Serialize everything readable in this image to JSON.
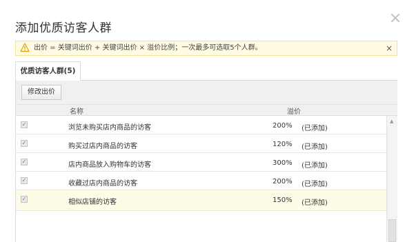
{
  "dialog": {
    "title": "添加优质访客人群",
    "close_glyph": "×"
  },
  "notice": {
    "icon": "warning-icon",
    "text": "出价 = 关键词出价 + 关键词出价 × 溢价比例；一次最多可选取5个人群。",
    "close_glyph": "×"
  },
  "tab": {
    "label": "优质访客人群(5)"
  },
  "toolbar": {
    "edit_bid_label": "修改出价"
  },
  "table": {
    "headers": {
      "name": "名称",
      "rate": "溢价"
    },
    "rows": [
      {
        "name": "浏览未购买店内商品的访客",
        "rate": "200%",
        "status": "(已添加)",
        "checked": true
      },
      {
        "name": "购买过店内商品的访客",
        "rate": "120%",
        "status": "(已添加)",
        "checked": true
      },
      {
        "name": "店内商品放入购物车的访客",
        "rate": "300%",
        "status": "(已添加)",
        "checked": true
      },
      {
        "name": "收藏过店内商品的访客",
        "rate": "200%",
        "status": "(已添加)",
        "checked": true
      },
      {
        "name": "相似店铺的访客",
        "rate": "150%",
        "status": "(已添加)",
        "checked": true
      }
    ]
  },
  "colors": {
    "notice_bg": "#fffbe3",
    "notice_border": "#f3e3a2",
    "highlight_row": "#fefbe6"
  }
}
